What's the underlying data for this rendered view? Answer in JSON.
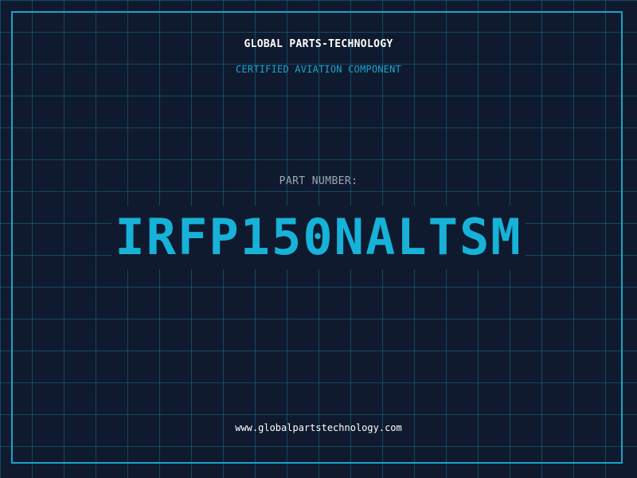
{
  "header": {
    "company": "GLOBAL PARTS-TECHNOLOGY",
    "tagline": "CERTIFIED AVIATION COMPONENT"
  },
  "part": {
    "label": "PART NUMBER:",
    "number": "IRFP150NALTSM"
  },
  "footer": {
    "url": "www.globalpartstechnology.com"
  },
  "colors": {
    "background": "#0f1a2f",
    "grid": "#1796b4",
    "accent": "#16b2d8",
    "border": "#19a3c8"
  }
}
